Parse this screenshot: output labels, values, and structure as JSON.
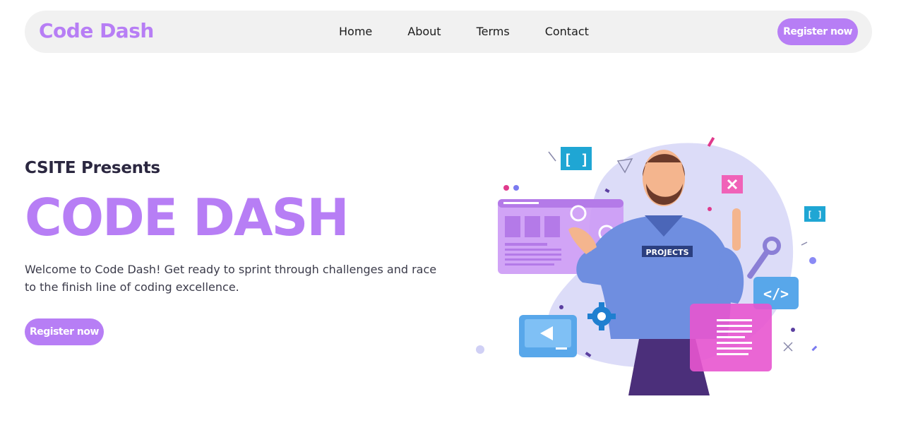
{
  "nav": {
    "brand": "Code Dash",
    "links": [
      "Home",
      "About",
      "Terms",
      "Contact"
    ],
    "cta": "Register now"
  },
  "hero": {
    "presents": "CSITE Presents",
    "title": "CODE DASH",
    "description": "Welcome to Code Dash! Get ready to sprint through challenges and race to the finish line of coding excellence.",
    "cta": "Register now"
  },
  "illustration": {
    "shirt_text": "PROJECTS",
    "bracket_glyph": "[ ]",
    "code_glyph": "</>"
  },
  "colors": {
    "accent": "#b77ef5",
    "nav_bg": "#f1f1f1",
    "text_dark": "#2b2740"
  },
  "icons": [
    "gear-icon",
    "wrench-icon",
    "close-icon",
    "play-icon",
    "code-icon",
    "bracket-icon"
  ]
}
